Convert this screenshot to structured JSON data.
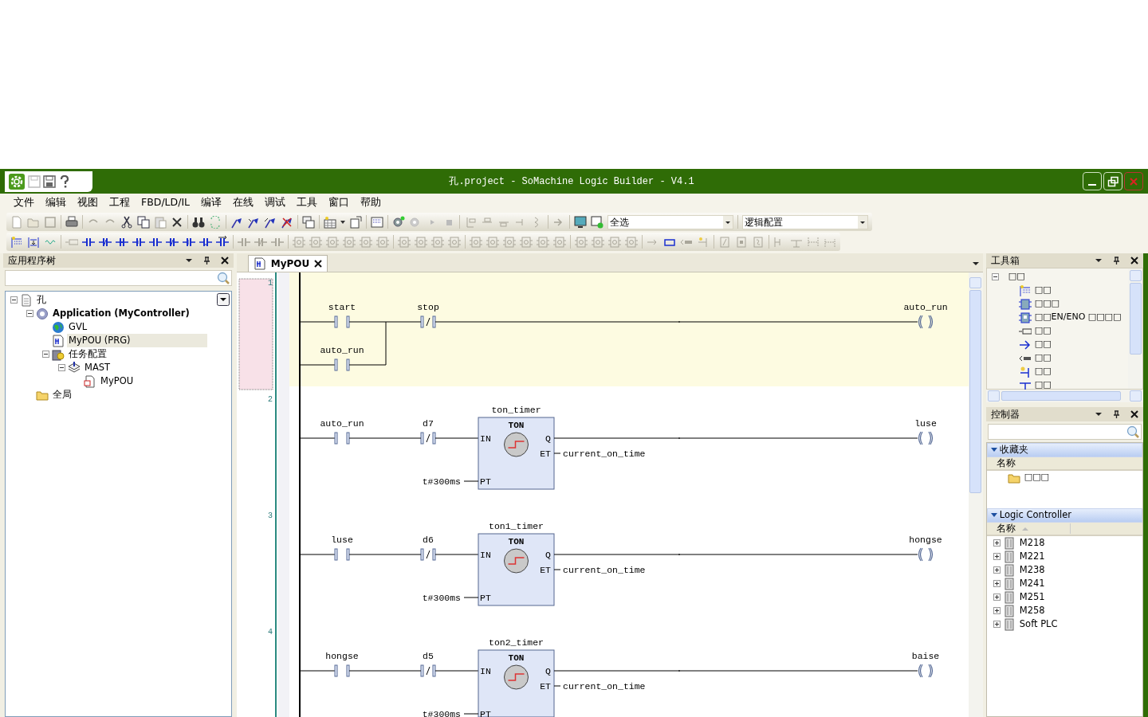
{
  "window": {
    "title": "孔.project - SoMachine Logic Builder - V4.1"
  },
  "menu": [
    "文件",
    "编辑",
    "视图",
    "工程",
    "FBD/LD/IL",
    "编译",
    "在线",
    "调试",
    "工具",
    "窗口",
    "帮助"
  ],
  "toolbar": {
    "selection": "全选",
    "configuration": "逻辑配置"
  },
  "app_tree": {
    "title": "应用程序树",
    "items": [
      {
        "label": "孔",
        "kind": "project",
        "expanded": true,
        "selected": false,
        "active": false,
        "children": [
          {
            "label": "Application (MyController)",
            "kind": "application",
            "expanded": true,
            "selected": false,
            "active": true,
            "children": [
              {
                "label": "GVL",
                "kind": "globals",
                "selected": false,
                "active": false
              },
              {
                "label": "MyPOU (PRG)",
                "kind": "pou",
                "selected": true,
                "active": false
              },
              {
                "label": "任务配置",
                "kind": "tasks",
                "expanded": true,
                "selected": false,
                "active": false,
                "children": [
                  {
                    "label": "MAST",
                    "kind": "task",
                    "expanded": true,
                    "selected": false,
                    "active": false,
                    "children": [
                      {
                        "label": "MyPOU",
                        "kind": "call",
                        "selected": false,
                        "active": false
                      }
                    ]
                  }
                ]
              }
            ]
          },
          {
            "label": "全局",
            "kind": "folder",
            "selected": false,
            "active": false
          }
        ]
      }
    ]
  },
  "editor": {
    "tabs": [
      {
        "label": "MyPOU",
        "selected": true
      }
    ],
    "networks": [
      {
        "number": "1",
        "selected": true,
        "contacts": [
          {
            "label": "start",
            "kind": "no"
          },
          {
            "label": "stop",
            "kind": "nc"
          }
        ],
        "parallel": {
          "label": "auto_run",
          "kind": "no"
        },
        "coil": "auto_run"
      },
      {
        "number": "2",
        "selected": false,
        "contacts": [
          {
            "label": "auto_run",
            "kind": "no"
          },
          {
            "label": "d7",
            "kind": "nc"
          }
        ],
        "block": {
          "instance": "ton_timer",
          "type": "TON",
          "inputs": [
            "IN",
            "PT"
          ],
          "outputs": [
            "Q",
            "ET"
          ],
          "pt": "t#300ms",
          "et": "current_on_time"
        },
        "coil": "luse"
      },
      {
        "number": "3",
        "selected": false,
        "contacts": [
          {
            "label": "luse",
            "kind": "no"
          },
          {
            "label": "d6",
            "kind": "nc"
          }
        ],
        "block": {
          "instance": "ton1_timer",
          "type": "TON",
          "inputs": [
            "IN",
            "PT"
          ],
          "outputs": [
            "Q",
            "ET"
          ],
          "pt": "t#300ms",
          "et": "current_on_time"
        },
        "coil": "hongse"
      },
      {
        "number": "4",
        "selected": false,
        "contacts": [
          {
            "label": "hongse",
            "kind": "no"
          },
          {
            "label": "d5",
            "kind": "nc"
          }
        ],
        "block": {
          "instance": "ton2_timer",
          "type": "TON",
          "inputs": [
            "IN",
            "PT"
          ],
          "outputs": [
            "Q",
            "ET"
          ],
          "pt": "t#300ms",
          "et": "current_on_time"
        },
        "coil": "baise"
      }
    ]
  },
  "toolbox": {
    "title": "工具箱",
    "group": {
      "label": "□□",
      "expanded": true
    },
    "items": [
      {
        "label": "□□",
        "kind": "network"
      },
      {
        "label": "□□□",
        "kind": "box"
      },
      {
        "label": "□□EN/ENO □□□□",
        "kind": "box-en"
      },
      {
        "label": "□□",
        "kind": "var"
      },
      {
        "label": "□□",
        "kind": "jump"
      },
      {
        "label": "□□",
        "kind": "return"
      },
      {
        "label": "□□",
        "kind": "insert"
      },
      {
        "label": "□□",
        "kind": "branch"
      }
    ]
  },
  "controller": {
    "title": "控制器",
    "sections": [
      {
        "title": "收藏夹",
        "expanded": true,
        "column": "名称",
        "sorted": false,
        "items": [
          {
            "label": "□□□",
            "kind": "folder"
          }
        ]
      },
      {
        "title": "Logic Controller",
        "expanded": true,
        "column": "名称",
        "sorted": true,
        "items": [
          {
            "label": "M218",
            "kind": "device",
            "expanded": false
          },
          {
            "label": "M221",
            "kind": "device",
            "expanded": false
          },
          {
            "label": "M238",
            "kind": "device",
            "expanded": false
          },
          {
            "label": "M241",
            "kind": "device",
            "expanded": false
          },
          {
            "label": "M251",
            "kind": "device",
            "expanded": false
          },
          {
            "label": "M258",
            "kind": "device",
            "expanded": false
          },
          {
            "label": "Soft PLC",
            "kind": "device",
            "expanded": false
          }
        ]
      }
    ]
  }
}
